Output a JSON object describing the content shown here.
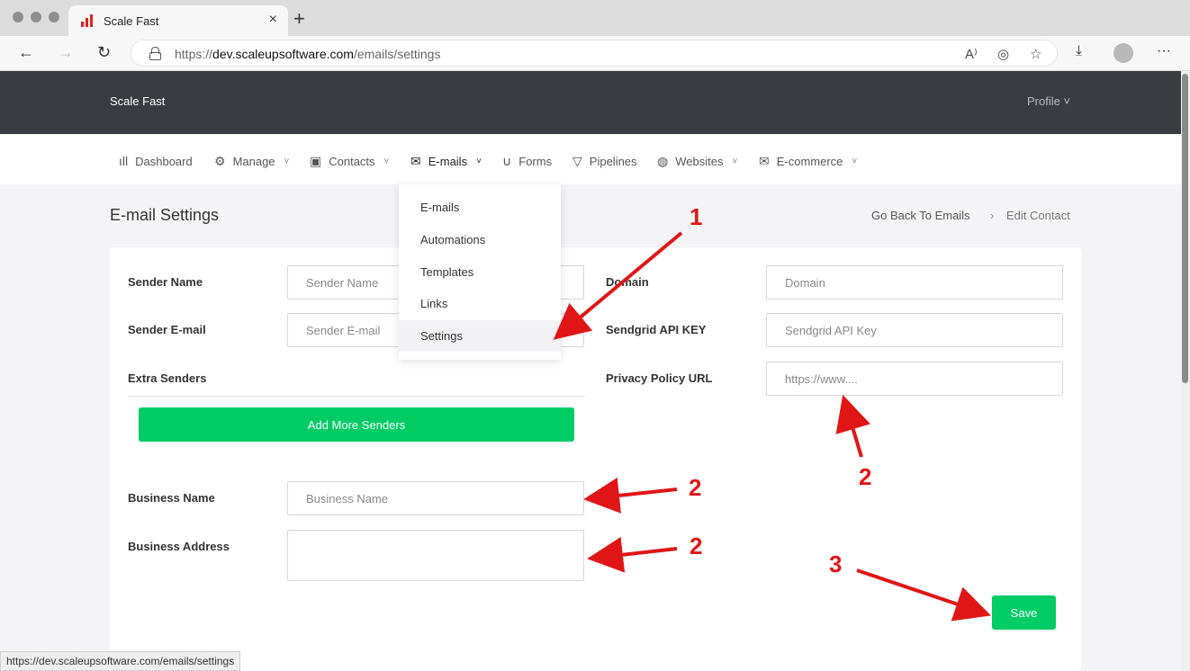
{
  "browser": {
    "tab_title": "Scale Fast",
    "tab_close": "×",
    "new_tab": "+",
    "back": "←",
    "forward": "→",
    "reload": "↻",
    "url_prefix": "https://",
    "url_host": "dev.scaleupsoftware.com",
    "url_path": "/emails/settings",
    "read_aloud": "A⁾",
    "tracking": "◎",
    "favorites": "☆",
    "downloads": "⤓",
    "more": "···",
    "status_url": "https://dev.scaleupsoftware.com/emails/settings"
  },
  "header": {
    "brand": "Scale Fast",
    "profile": "Profile ˅"
  },
  "nav": {
    "items": [
      {
        "icon": "ıll",
        "label": "Dashboard",
        "chevron": ""
      },
      {
        "icon": "⚙",
        "label": "Manage",
        "chevron": "˅"
      },
      {
        "icon": "▣",
        "label": "Contacts",
        "chevron": "˅"
      },
      {
        "icon": "✉",
        "label": "E-mails",
        "chevron": "˅"
      },
      {
        "icon": "∪",
        "label": "Forms",
        "chevron": ""
      },
      {
        "icon": "▽",
        "label": "Pipelines",
        "chevron": ""
      },
      {
        "icon": "◍",
        "label": "Websites",
        "chevron": "˅"
      },
      {
        "icon": "✉",
        "label": "E-commerce",
        "chevron": "˅"
      }
    ]
  },
  "dropdown": {
    "items": [
      "E-mails",
      "Automations",
      "Templates",
      "Links",
      "Settings"
    ]
  },
  "page": {
    "title": "E-mail Settings",
    "crumb_back": "Go Back To Emails",
    "crumb_sep": "›",
    "crumb_current": "Edit Contact"
  },
  "form": {
    "sender_name_label": "Sender Name",
    "sender_name_placeholder": "Sender Name",
    "sender_email_label": "Sender E-mail",
    "sender_email_placeholder": "Sender E-mail",
    "extra_senders_label": "Extra Senders",
    "add_senders_button": "Add More Senders",
    "business_name_label": "Business Name",
    "business_name_placeholder": "Business Name",
    "business_address_label": "Business Address",
    "domain_label": "Domain",
    "domain_placeholder": "Domain",
    "sendgrid_label": "Sendgrid API KEY",
    "sendgrid_placeholder": "Sendgrid API Key",
    "privacy_label": "Privacy Policy URL",
    "privacy_placeholder": "https://www....",
    "save_button": "Save"
  },
  "annotations": {
    "n1": "1",
    "n2a": "2",
    "n2b": "2",
    "n2c": "2",
    "n3": "3",
    "color": "#e01616"
  }
}
